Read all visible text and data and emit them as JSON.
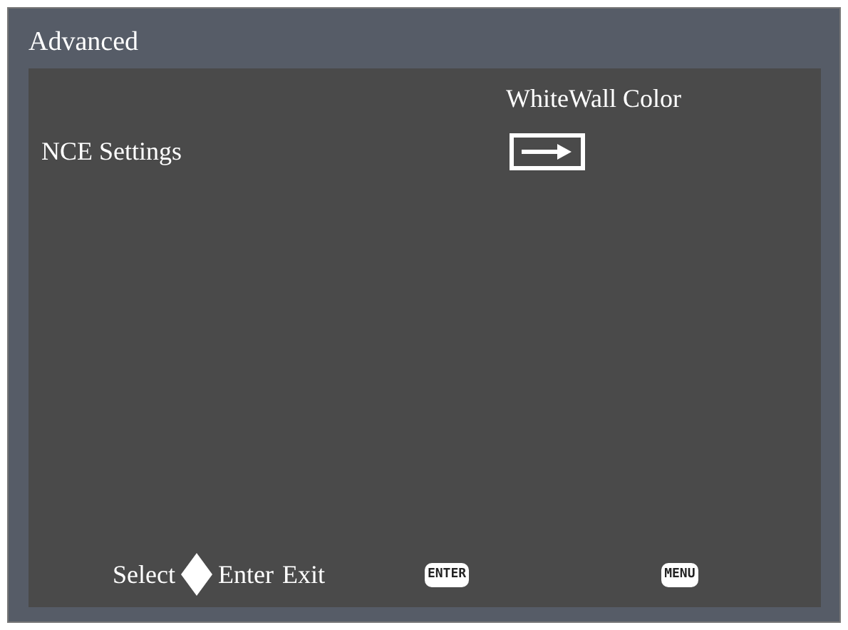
{
  "window": {
    "title": "Advanced"
  },
  "column_heading": "WhiteWall Color",
  "items": [
    {
      "label": "NCE Settings",
      "kind": "submenu"
    }
  ],
  "footer": {
    "hints": [
      "Select",
      "Enter",
      "Exit"
    ],
    "keys": [
      "ENTER",
      "MENU"
    ]
  }
}
